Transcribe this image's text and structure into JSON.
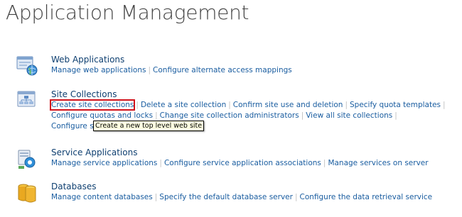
{
  "page_title": "Application Management",
  "sections": {
    "web_applications": {
      "title": "Web Applications",
      "icon": "web-application-icon",
      "links": [
        "Manage web applications",
        "Configure alternate access mappings"
      ]
    },
    "site_collections": {
      "title": "Site Collections",
      "icon": "site-collection-icon",
      "links": [
        "Create site collections",
        "Delete a site collection",
        "Confirm site use and deletion",
        "Specify quota templates",
        "Configure quotas and locks",
        "Change site collection administrators",
        "View all site collections",
        "Configure self-service site creation"
      ]
    },
    "service_applications": {
      "title": "Service Applications",
      "icon": "service-application-icon",
      "links": [
        "Manage service applications",
        "Configure service application associations",
        "Manage services on server"
      ]
    },
    "databases": {
      "title": "Databases",
      "icon": "database-icon",
      "links": [
        "Manage content databases",
        "Specify the default database server",
        "Configure the data retrieval service"
      ]
    }
  },
  "tooltip": "Create a new top level web site",
  "colors": {
    "link": "#1a5da0",
    "title": "#0e3f70",
    "highlight": "#d0121b",
    "tooltip_bg": "#ffffe1"
  }
}
